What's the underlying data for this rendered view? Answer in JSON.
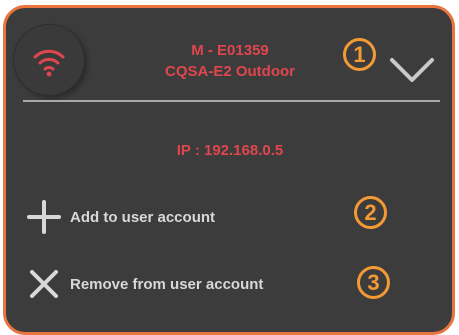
{
  "device": {
    "id": "M - E01359",
    "model": "CQSA-E2 Outdoor",
    "ip": "IP : 192.168.0.5",
    "status_icon": "wifi-icon"
  },
  "actions": {
    "add_label": "Add to user account",
    "remove_label": "Remove from user account"
  },
  "callouts": [
    "1",
    "2",
    "3"
  ],
  "colors": {
    "accent_red": "#e0464e",
    "callout_orange": "#f49a35",
    "panel_border": "#e9743e",
    "panel_bg": "#3c3c3c"
  }
}
